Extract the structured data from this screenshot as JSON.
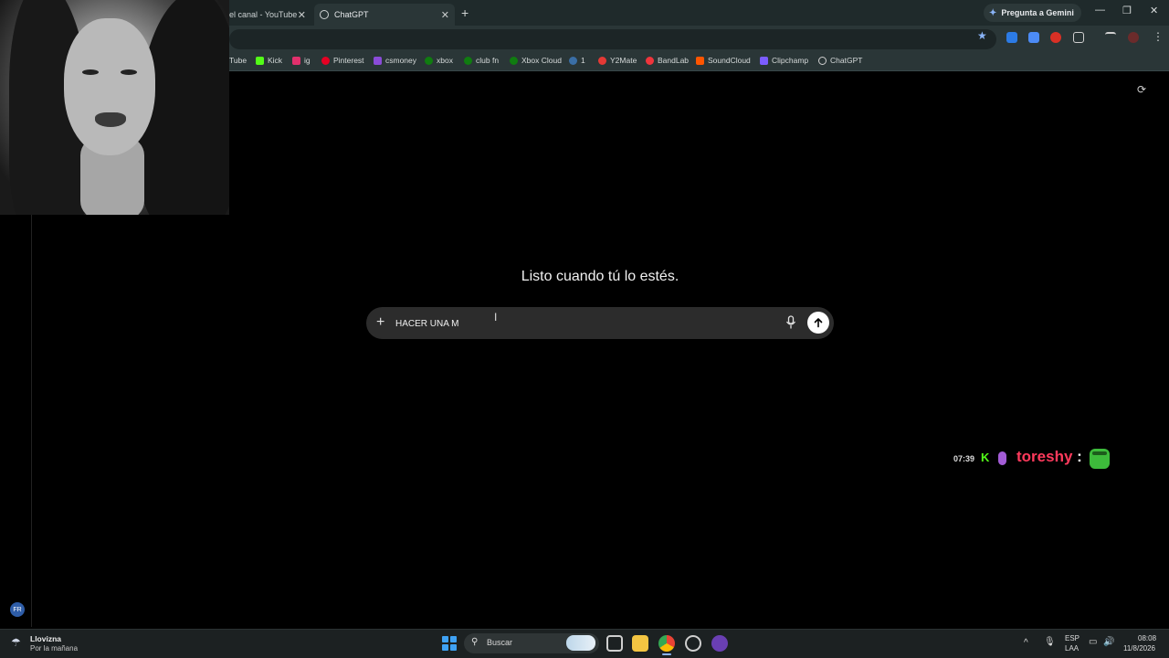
{
  "browser": {
    "tabs": [
      {
        "label": "el canal - YouTube",
        "active": false
      },
      {
        "label": "ChatGPT",
        "active": true
      }
    ],
    "new_tab_icon": "plus-icon",
    "gemini_button": "Pregunta a Gemini",
    "window_controls": [
      "minimize-icon",
      "restore-icon",
      "close-icon"
    ]
  },
  "bookmarks": [
    {
      "label": "Tube",
      "color": "#ff0000"
    },
    {
      "label": "Kick",
      "color": "#53fc18"
    },
    {
      "label": "ig",
      "color": "#e1306c"
    },
    {
      "label": "Pinterest",
      "color": "#e60023"
    },
    {
      "label": "csmoney",
      "color": "#8a4bd8"
    },
    {
      "label": "xbox",
      "color": "#107c10"
    },
    {
      "label": "club fn",
      "color": "#107c10"
    },
    {
      "label": "Xbox Cloud",
      "color": "#107c10"
    },
    {
      "label": "1",
      "color": "#3a6ea5"
    },
    {
      "label": "Y2Mate",
      "color": "#e53935"
    },
    {
      "label": "BandLab",
      "color": "#f0353c"
    },
    {
      "label": "SoundCloud",
      "color": "#ff5500"
    },
    {
      "label": "Clipchamp",
      "color": "#7b5cff"
    },
    {
      "label": "ChatGPT",
      "color": "#d0d0d0"
    }
  ],
  "chatgpt": {
    "headline": "Listo cuando tú lo estés.",
    "input_value": "HACER UNA M",
    "plus_icon": "plus-icon",
    "mic_icon": "microphone-icon",
    "send_icon": "arrow-up-icon"
  },
  "chat_overlay": {
    "time": "07:39",
    "badge": "K",
    "username": "toreshy",
    "separator": ":",
    "username_color": "#ff3a5c"
  },
  "notification_badge": "FR",
  "taskbar": {
    "weather_title": "Llovizna",
    "weather_subtitle": "Por la mañana",
    "search_label": "Buscar",
    "language_top": "ESP",
    "language_bottom": "LAA",
    "time": "08:08",
    "date": "11/8/2026"
  }
}
